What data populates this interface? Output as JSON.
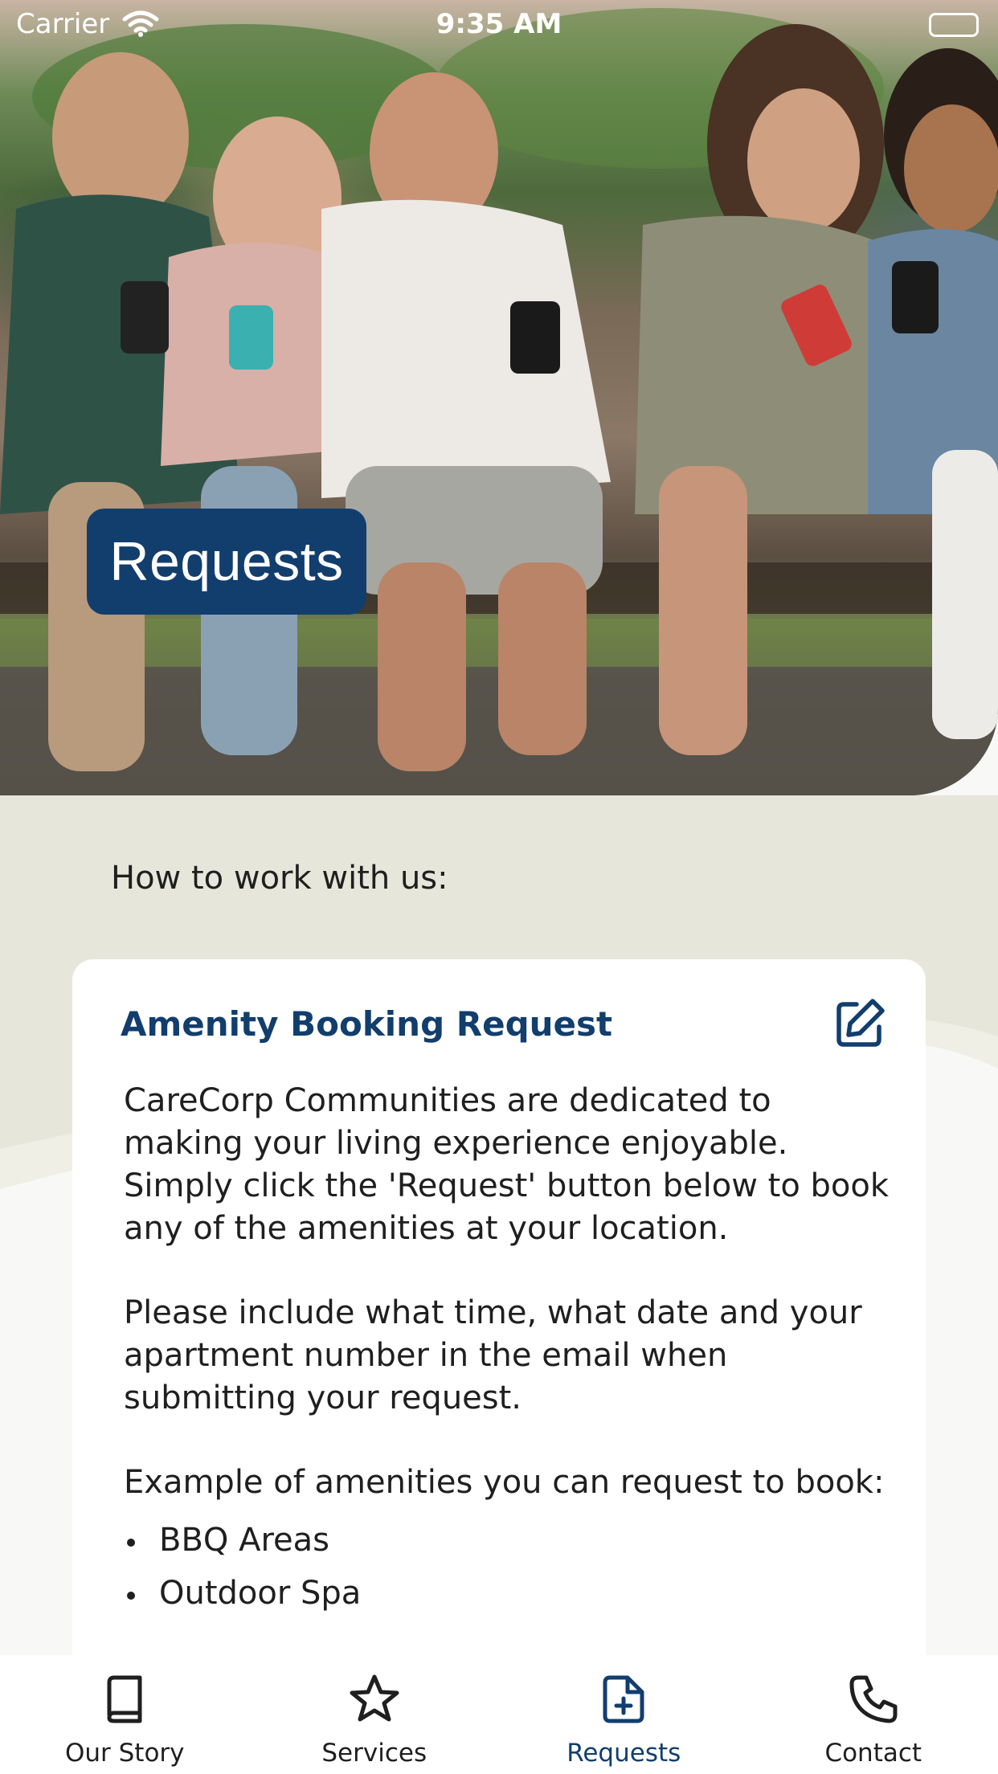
{
  "status_bar": {
    "carrier": "Carrier",
    "time": "9:35 AM"
  },
  "hero": {
    "title": "Requests"
  },
  "section": {
    "heading": "How to work with us:"
  },
  "card": {
    "title": "Amenity Booking Request",
    "edit_icon": "edit-icon",
    "paragraphs": [
      "CareCorp Communities are dedicated to making your living experience enjoyable. Simply click the 'Request' button below to book any of the amenities at your location.",
      "Please include what time, what date and your apartment number in the email when submitting your request.",
      "Example of amenities you can request to book:"
    ],
    "amenities": [
      "BBQ Areas",
      "Outdoor Spa"
    ]
  },
  "tabs": [
    {
      "label": "Our Story",
      "icon": "book-icon"
    },
    {
      "label": "Services",
      "icon": "star-icon"
    },
    {
      "label": "Requests",
      "icon": "file-plus-icon",
      "active": true
    },
    {
      "label": "Contact",
      "icon": "phone-icon"
    }
  ],
  "colors": {
    "brand": "#123e6e",
    "background": "#e6e6da",
    "card": "#ffffff"
  }
}
